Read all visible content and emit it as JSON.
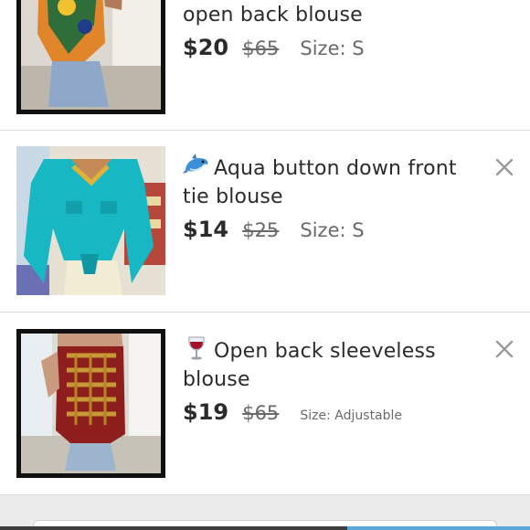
{
  "listings": [
    {
      "title_lines": [
        "open back blouse"
      ],
      "price": "$20",
      "original_price": "$65",
      "size": "Size: S",
      "emoji": ""
    },
    {
      "title_lines": [
        "Aqua button down front",
        "tie blouse"
      ],
      "price": "$14",
      "original_price": "$25",
      "size": "Size: S",
      "emoji": "dolphin-emoji"
    },
    {
      "title_lines": [
        "Open back sleeveless",
        "blouse"
      ],
      "price": "$19",
      "original_price": "$65",
      "size": "Size: Adjustable",
      "emoji": "wine-glass-emoji"
    }
  ],
  "colors": {
    "text": "#2b2b2b",
    "muted": "#6a6a6a",
    "divider": "#dcdcdc",
    "aqua_top": "#17b7c4",
    "accent": "#5aa7d8"
  },
  "icons": {
    "remove": "close-icon"
  }
}
